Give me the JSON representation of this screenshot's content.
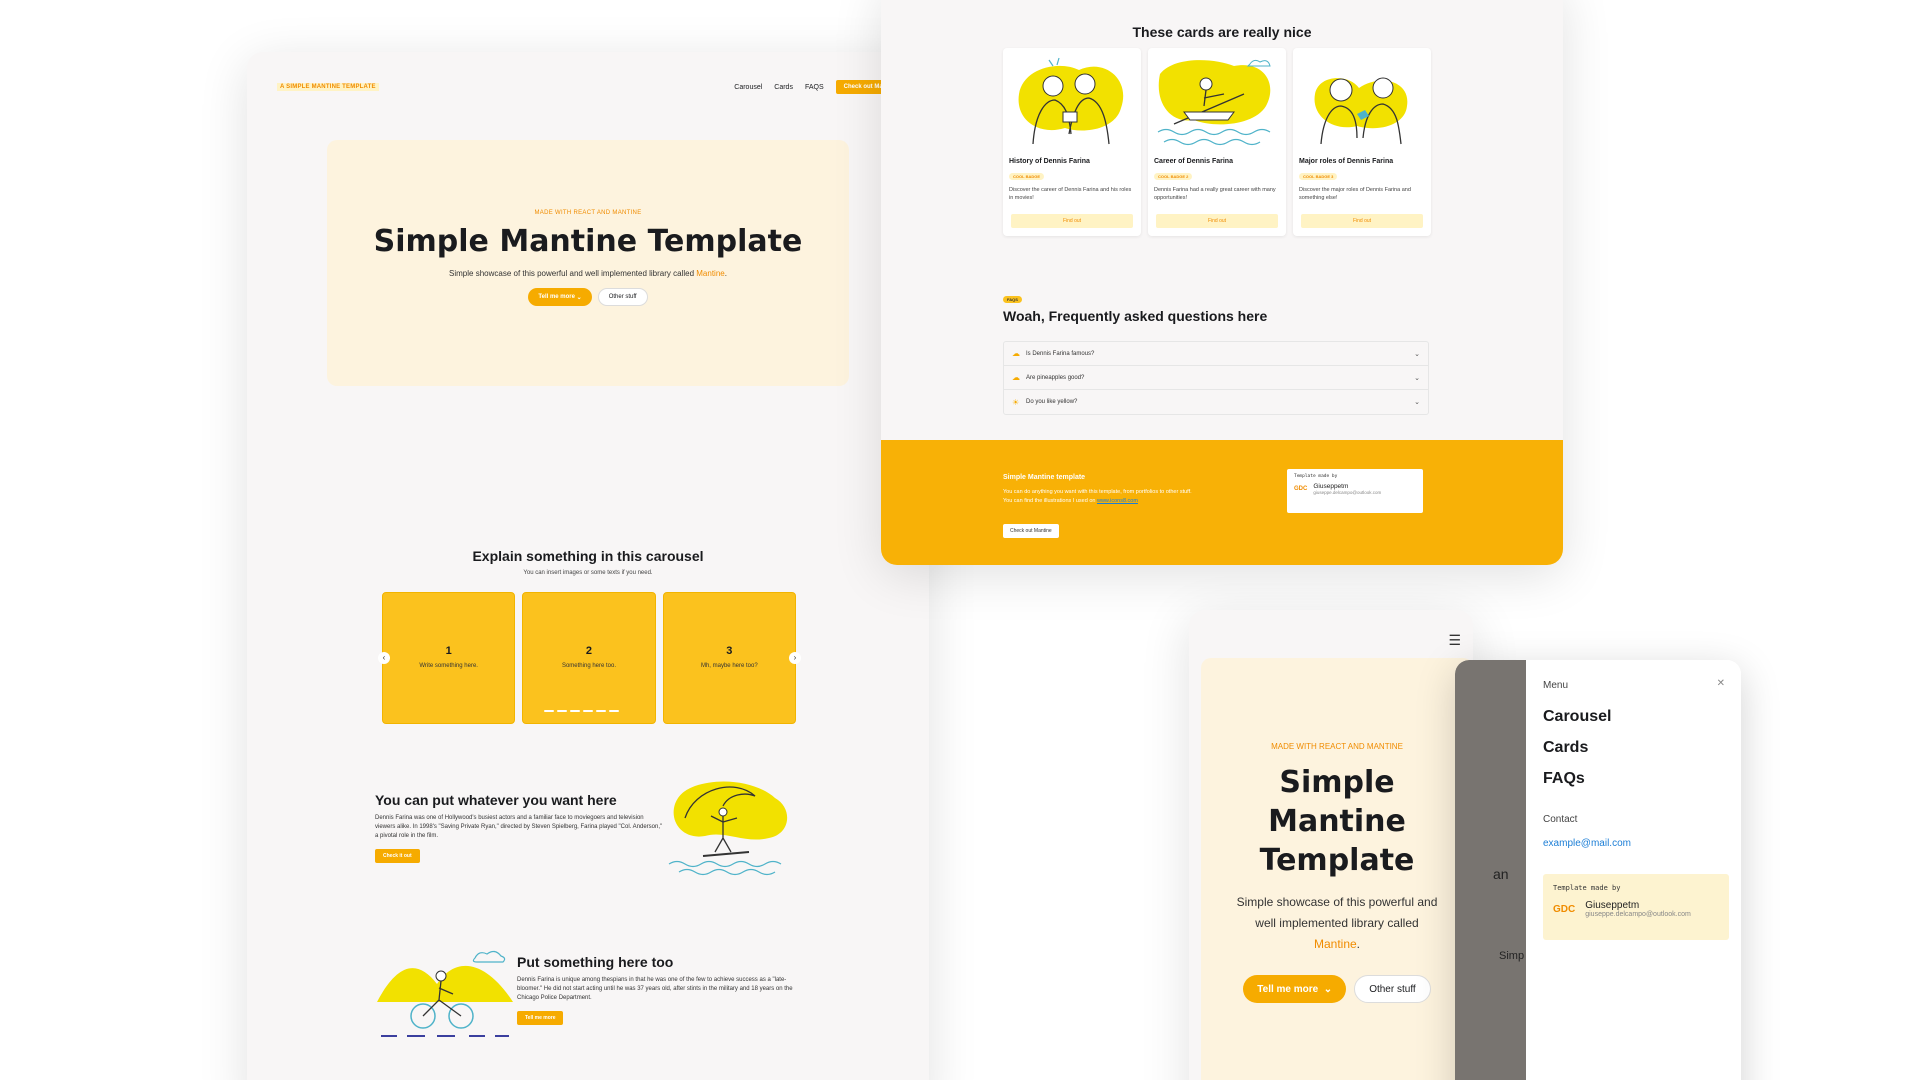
{
  "desktop": {
    "brand": "A SIMPLE MANTINE TEMPLATE",
    "nav": [
      "Carousel",
      "Cards",
      "FAQS"
    ],
    "nav_cta": "Check out Mantine",
    "hero": {
      "eyebrow": "MADE WITH REACT AND MANTINE",
      "title": "Simple Mantine Template",
      "subtitle_pre": "Simple showcase of this powerful and well implemented library called ",
      "subtitle_link": "Mantine",
      "subtitle_post": ".",
      "primary_btn": "Tell me more",
      "secondary_btn": "Other stuff"
    },
    "carousel": {
      "title": "Explain something in this carousel",
      "subtitle": "You can insert images or some texts if you need.",
      "slides": [
        {
          "num": "1",
          "text": "Write something here."
        },
        {
          "num": "2",
          "text": "Something here too."
        },
        {
          "num": "3",
          "text": "Mh, maybe here too?"
        }
      ],
      "prev_icon": "chevron-left-icon",
      "next_icon": "chevron-right-icon"
    },
    "feature1": {
      "title": "You can put whatever you want here",
      "body": "Dennis Farina was one of Hollywood's busiest actors and a familiar face to moviegoers and television viewers alike. In 1998's \"Saving Private Ryan,\" directed by Steven Spielberg, Farina played \"Col. Anderson,\" a pivotal role in the film.",
      "button": "Check it out"
    },
    "feature2": {
      "title": "Put something here too",
      "body": "Dennis Farina is unique among thespians in that he was one of the few to achieve success as a \"late-bloomer.\" He did not start acting until he was 37 years old, after stints in the military and 18 years on the Chicago Police Department.",
      "button": "Tell me more"
    }
  },
  "cards_page": {
    "title": "These cards are really nice",
    "cards": [
      {
        "title": "History of Dennis Farina",
        "badge": "COOL BADGE",
        "desc": "Discover the career of Dennis Farina and his roles in movies!",
        "button": "Find out"
      },
      {
        "title": "Career of Dennis Farina",
        "badge": "COOL BADGE 2",
        "desc": "Dennis Farina had a really great career with many opportunities!",
        "button": "Find out"
      },
      {
        "title": "Major roles of Dennis Farina",
        "badge": "COOL BADGE 3",
        "desc": "Discover the major roles of Dennis Farina and something else!",
        "button": "Find out"
      }
    ],
    "faq_badge": "FAQS",
    "faq_title": "Woah, Frequently asked questions here",
    "faqs": [
      "Is Dennis Farina famous?",
      "Are pineapples good?",
      "Do you like yellow?"
    ],
    "footer": {
      "title": "Simple Mantine template",
      "line1": "You can do anything you want with this template, from portfolios to other stuff.",
      "line2_pre": "You can find the illustrations I used on ",
      "line2_link": "www.icons8.com",
      "button": "Check out Mantine"
    }
  },
  "made_by": {
    "label": "Template made by",
    "logo": "GDC",
    "name": "Giuseppetm",
    "email": "giuseppe.delcampo@outlook.com"
  },
  "mobile": {
    "eyebrow": "MADE WITH REACT AND MANTINE",
    "title": "Simple Mantine Template",
    "subtitle_pre": "Simple showcase of this powerful and well implemented library called ",
    "subtitle_link": "Mantine",
    "subtitle_post": ".",
    "primary_btn": "Tell me more",
    "secondary_btn": "Other stuff",
    "menu_icon": "hamburger-icon"
  },
  "drawer": {
    "menu_label": "Menu",
    "links": [
      "Carousel",
      "Cards",
      "FAQs"
    ],
    "contact_label": "Contact",
    "email": "example@mail.com",
    "peek1": "Simp",
    "peek2": "an",
    "close_icon": "close-icon"
  },
  "colors": {
    "accent": "#f6ab00",
    "slide": "#fbc21e",
    "hero_bg": "#fdf3de",
    "link_orange": "#f08c00",
    "link_blue": "#1c7ed6"
  }
}
